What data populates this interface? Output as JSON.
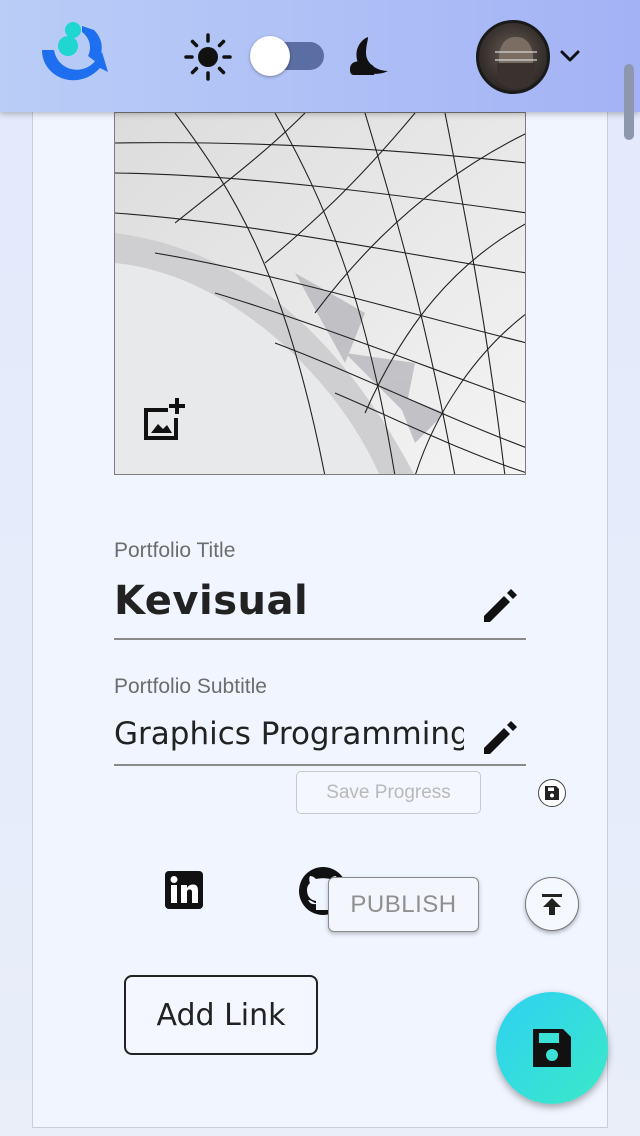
{
  "header": {
    "logo_icon": "app-logo-icon",
    "theme_toggle": {
      "left_icon": "sun-icon",
      "right_icon": "moon-icon",
      "state": "light"
    },
    "account_menu_icon": "chevron-down-icon"
  },
  "editor": {
    "cover_image_action_icon": "add-photo-icon",
    "title": {
      "label": "Portfolio Title",
      "value": "Kevisual",
      "edit_icon": "pencil-icon"
    },
    "subtitle": {
      "label": "Portfolio Subtitle",
      "value": "Graphics Programming",
      "edit_icon": "pencil-icon"
    },
    "save_progress_label": "Save Progress",
    "social_links": [
      {
        "icon": "linkedin-icon"
      },
      {
        "icon": "github-icon"
      }
    ],
    "publish_label": "PUBLISH",
    "add_link_label": "Add Link"
  },
  "colors": {
    "header_start": "#b9cdf7",
    "header_end": "#a3b2f5",
    "fab_start": "#2ed1f2",
    "fab_end": "#3be9c8",
    "logo_blue": "#1e6ff0",
    "logo_cyan": "#1fd6d0"
  }
}
